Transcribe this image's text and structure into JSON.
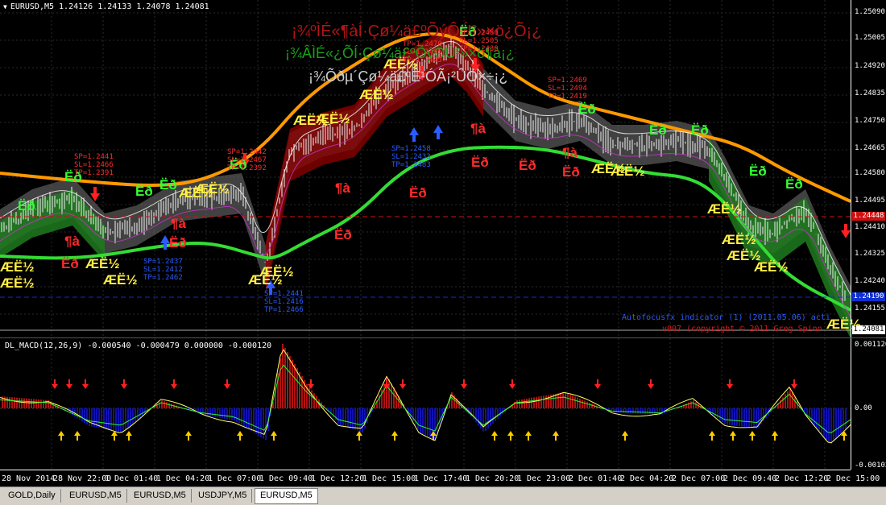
{
  "chart": {
    "symbol_header": "EURUSD,M5  1.24126 1.24133 1.24078 1.24081",
    "price_ticks": [
      "1.25090",
      "1.25005",
      "1.24920",
      "1.24835",
      "1.24750",
      "1.24665",
      "1.24580",
      "1.24495",
      "1.24410",
      "1.24325",
      "1.24240",
      "1.24155"
    ],
    "price_tag_red": "1.24448",
    "price_tag_blue": "1.24190",
    "price_tag_current": "1.24081",
    "time_labels": [
      "28 Nov 2014",
      "28 Nov 22:00",
      "1 Dec 01:40",
      "1 Dec 04:20",
      "1 Dec 07:00",
      "1 Dec 09:40",
      "1 Dec 12:20",
      "1 Dec 15:00",
      "1 Dec 17:40",
      "1 Dec 20:20",
      "1 Dec 23:00",
      "2 Dec 01:40",
      "2 Dec 04:20",
      "2 Dec 07:00",
      "2 Dec 09:40",
      "2 Dec 12:20",
      "2 Dec 15:00"
    ],
    "overlay_line1": "¡¾ºÌÉ«¶àÍ·Çø¼ä£ºÕýÔÚ²»×ö¿Õ¡¿",
    "overlay_line2": "¡¾ÂÌÉ«¿ÕÍ·Çø¼ä£ºÕýÔÚ²»×ö¶à¡¿",
    "overlay_line3": "¡¾Õðµ´Çø¼ä£ºÊ¹ÓÃ¡²ÛÖ×÷¡¿",
    "credit_line1": "Autofocusfx indicator (1) (2011.05.06) acti",
    "credit_line2": "v007 (copyright © 2011 Greg Spinn"
  },
  "signals": {
    "buy_label": "Ëð",
    "sell_label": "ÆË½",
    "short_label": "¶à",
    "tp_sets": [
      [
        "SP=1.2441",
        "SL=1.2466",
        "TP=1.2391"
      ],
      [
        "SP=1.2442",
        "SL=1.2467",
        "TP=1.2392"
      ],
      [
        "TP=1.2470",
        "SL=1.2495",
        "TP=1.2445"
      ],
      [
        "SP=1.2480",
        "SL=1.2505",
        "TP=1.2430"
      ],
      [
        "SP=1.2469",
        "SL=1.2494",
        "TP=1.2419"
      ],
      [
        "SP=1.2437",
        "SL=1.2412",
        "TP=1.2462"
      ],
      [
        "SP=1.2458",
        "SL=1.2433",
        "TP=1.2483"
      ],
      [
        "SP=1.2441",
        "SL=1.2416",
        "TP=1.2466"
      ]
    ]
  },
  "macd": {
    "header": "DL_MACD(12,26,9) -0.000540 -0.000479 0.000000 -0.000120",
    "ticks": [
      "0.001126",
      "0.00",
      "-0.001023"
    ]
  },
  "tabs": [
    "GOLD,Daily",
    "EURUSD,M5",
    "EURUSD,M5",
    "USDJPY,M5",
    "EURUSD,M5"
  ],
  "active_tab": 4,
  "colors": {
    "upper_band": "#ff9900",
    "lower_band": "#33dd33",
    "bull_fill": "#8b0000",
    "bear_fill": "#1f7a1f",
    "range_fill": "#777777",
    "macd_pos": "#b01010",
    "macd_neg": "#1010b0"
  }
}
